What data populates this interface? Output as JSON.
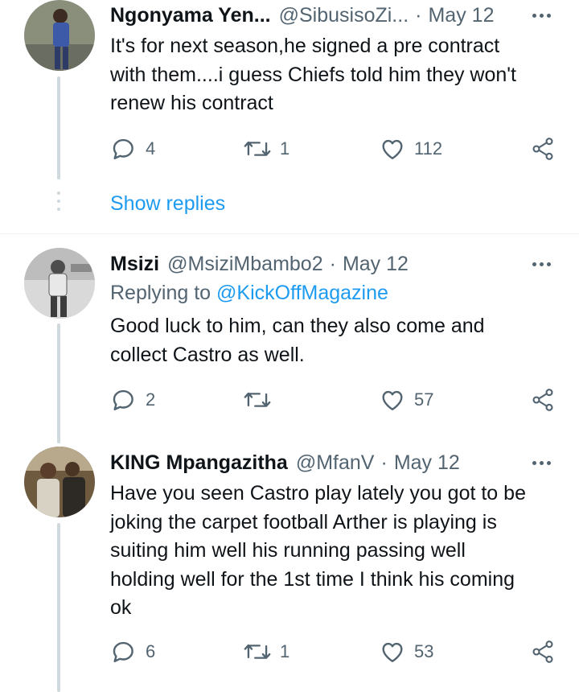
{
  "tweets": [
    {
      "name": "Ngonyama Yen...",
      "handle": "@SibusisoZi...",
      "dot": "·",
      "date": "May 12",
      "lines": [
        "It's for next season,he signed a pre contract",
        "with them....i guess Chiefs told him they won't",
        "renew his contract"
      ],
      "replies": "4",
      "retweets": "1",
      "likes": "112",
      "show_replies": "Show replies"
    },
    {
      "name": "Msizi",
      "handle": "@MsiziMbambo2",
      "dot": "·",
      "date": "May 12",
      "replying_prefix": "Replying to",
      "replying_to": "@KickOffMagazine",
      "lines": [
        "Good luck to him, can they also come and",
        "collect Castro as well."
      ],
      "replies": "2",
      "retweets": "",
      "likes": "57"
    },
    {
      "name": "KING Mpangazitha",
      "handle": "@MfanV",
      "dot": "·",
      "date": "May 12",
      "lines": [
        "Have you seen Castro play lately you got to be",
        "joking the carpet football Arther is playing is",
        "suiting him well his running passing well",
        "holding well for the 1st time I think his coming",
        "ok"
      ],
      "replies": "6",
      "retweets": "1",
      "likes": "53"
    }
  ],
  "icons": {
    "reply": "reply-icon",
    "retweet": "retweet-icon",
    "like": "heart-icon",
    "share": "share-icon",
    "more": "more-options-icon"
  },
  "colors": {
    "text": "#0f1419",
    "secondary": "#536471",
    "accent": "#1d9bf0",
    "thread_line": "#cfd9de"
  }
}
